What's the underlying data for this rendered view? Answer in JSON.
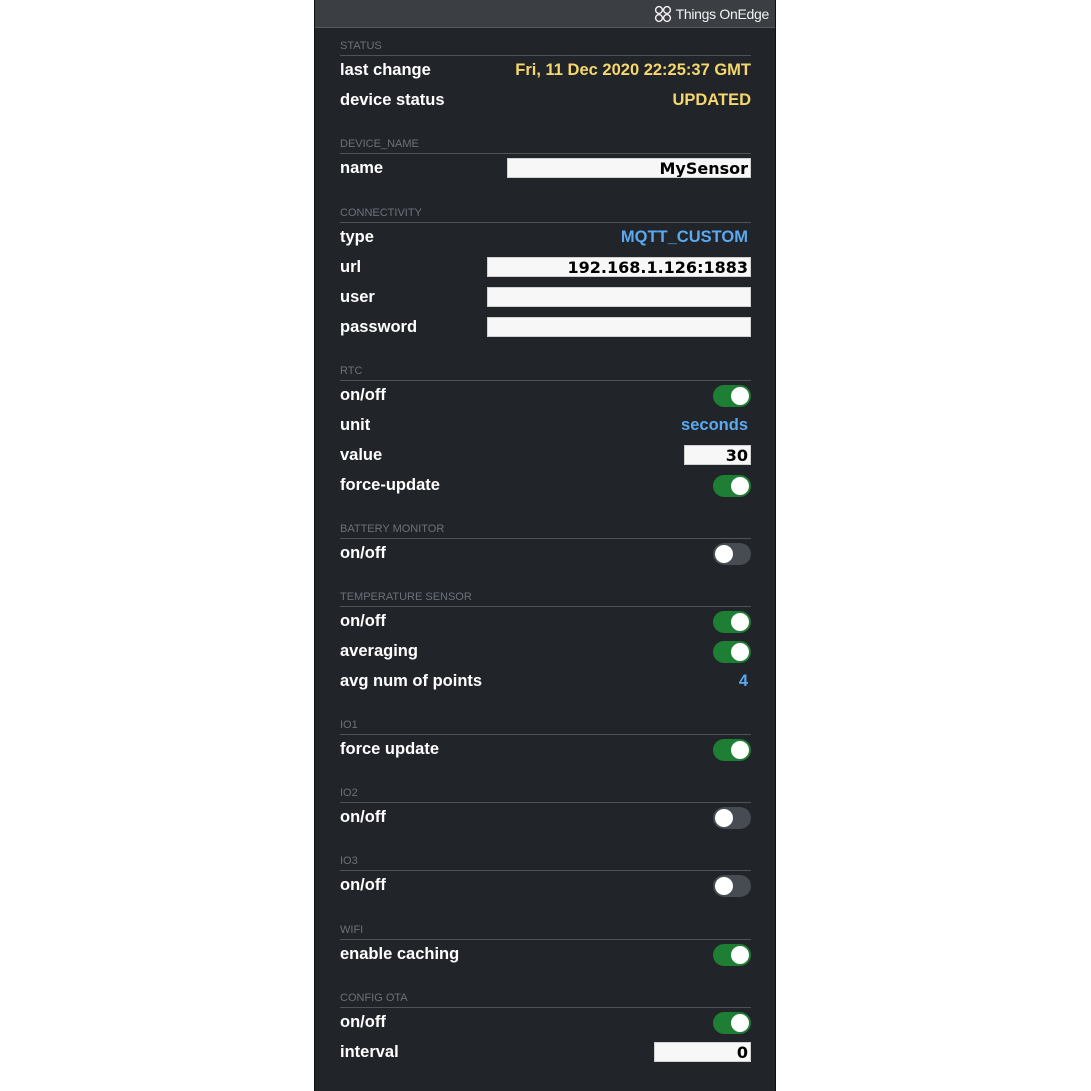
{
  "brand": {
    "name": "Things OnEdge"
  },
  "status": {
    "title": "STATUS",
    "last_change_label": "last change",
    "last_change_value": "Fri, 11 Dec 2020 22:25:37 GMT",
    "device_status_label": "device status",
    "device_status_value": "UPDATED"
  },
  "device_name": {
    "title": "DEVICE_NAME",
    "name_label": "name",
    "name_value": "MySensor"
  },
  "connectivity": {
    "title": "CONNECTIVITY",
    "type_label": "type",
    "type_value": "MQTT_CUSTOM",
    "url_label": "url",
    "url_value": "192.168.1.126:1883",
    "user_label": "user",
    "user_value": "",
    "password_label": "password",
    "password_value": ""
  },
  "rtc": {
    "title": "RTC",
    "onoff_label": "on/off",
    "onoff": true,
    "unit_label": "unit",
    "unit_value": "seconds",
    "value_label": "value",
    "value_value": "30",
    "force_update_label": "force-update",
    "force_update": true
  },
  "battery_monitor": {
    "title": "BATTERY MONITOR",
    "onoff_label": "on/off",
    "onoff": false
  },
  "temperature_sensor": {
    "title": "TEMPERATURE SENSOR",
    "onoff_label": "on/off",
    "onoff": true,
    "averaging_label": "averaging",
    "averaging": true,
    "avg_points_label": "avg num of points",
    "avg_points_value": "4"
  },
  "io1": {
    "title": "IO1",
    "force_update_label": "force update",
    "force_update": true
  },
  "io2": {
    "title": "IO2",
    "onoff_label": "on/off",
    "onoff": false
  },
  "io3": {
    "title": "IO3",
    "onoff_label": "on/off",
    "onoff": false
  },
  "wifi": {
    "title": "WIFI",
    "caching_label": "enable caching",
    "caching": true
  },
  "config_ota": {
    "title": "CONFIG OTA",
    "onoff_label": "on/off",
    "onoff": true,
    "interval_label": "interval",
    "interval_value": "0"
  },
  "colors": {
    "panel_bg": "#212428",
    "accent_yellow": "#f5d76e",
    "accent_blue": "#5aa9f2",
    "toggle_on": "#1e7e34",
    "toggle_off": "#474b52"
  }
}
